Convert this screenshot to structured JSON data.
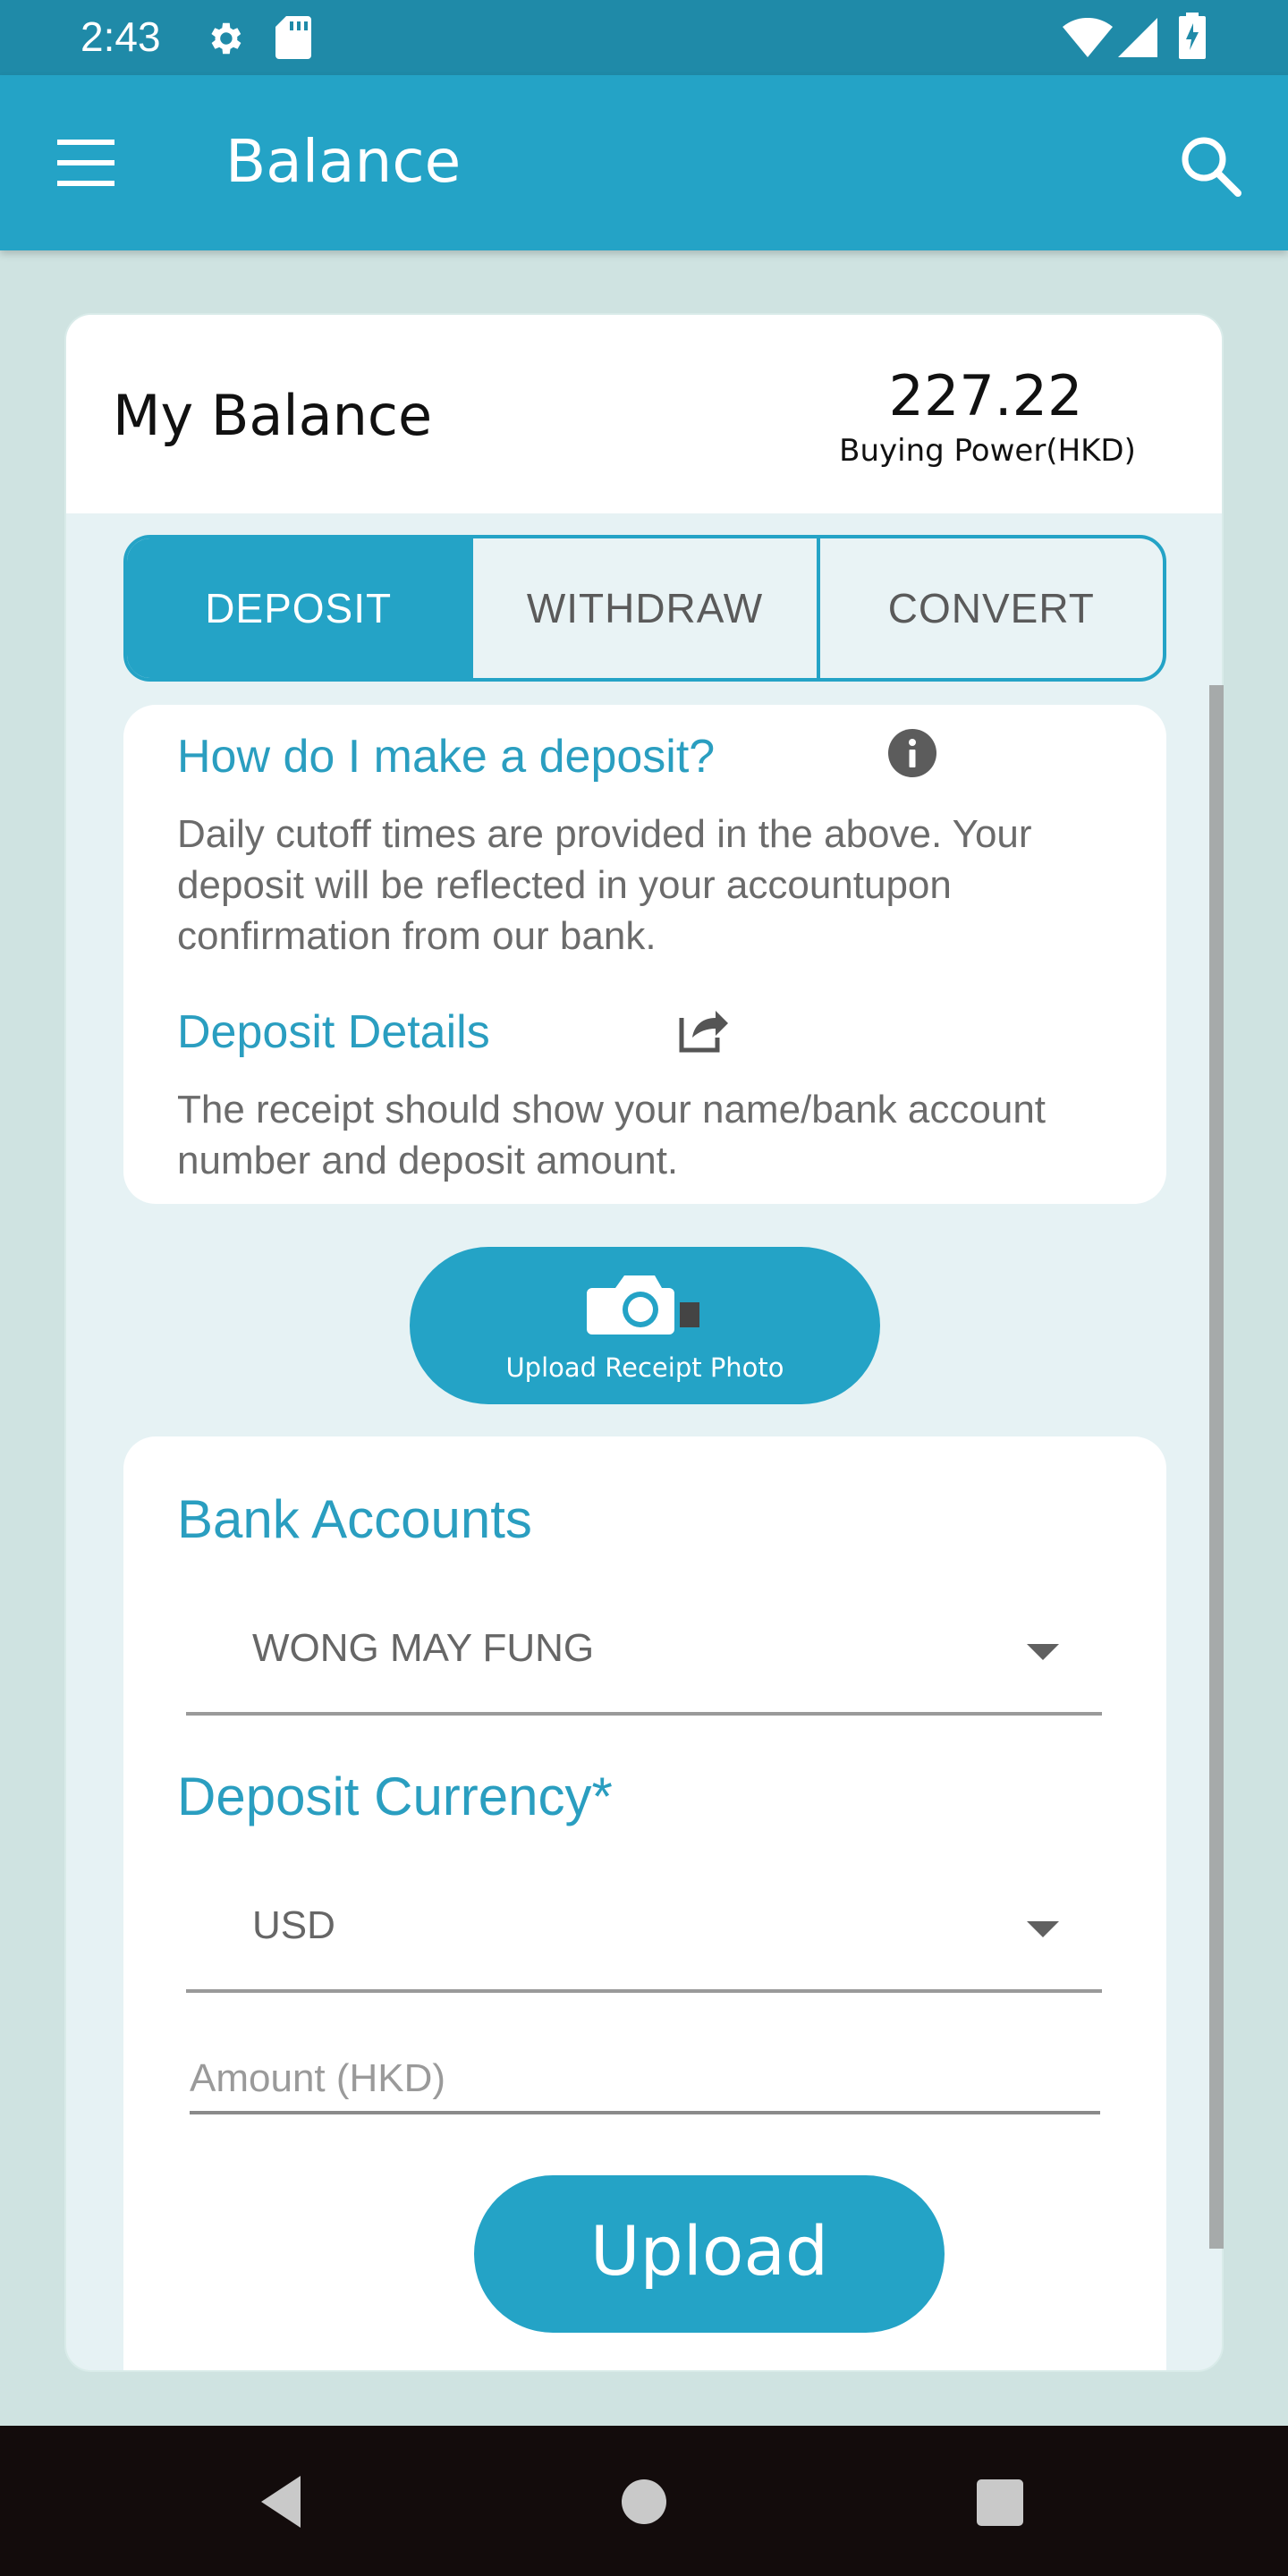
{
  "status_bar": {
    "time": "2:43",
    "icons": [
      "settings-icon",
      "sd-card-icon",
      "wifi-icon",
      "signal-icon",
      "battery-charging-icon"
    ]
  },
  "app_bar": {
    "title": "Balance",
    "menu_icon": "hamburger-menu-icon",
    "search_icon": "search-icon",
    "color": "#24a3c6"
  },
  "balance": {
    "title": "My Balance",
    "amount": "227.22",
    "label": "Buying Power(HKD)"
  },
  "tabs": [
    {
      "label": "DEPOSIT",
      "active": true
    },
    {
      "label": "WITHDRAW",
      "active": false
    },
    {
      "label": "CONVERT",
      "active": false
    }
  ],
  "info": {
    "question": "How do I make a deposit?",
    "question_icon": "info-icon",
    "text": "Daily cutoff times are provided in the above. Your deposit will be reflected in your accountupon confirmation from our bank.",
    "details_title": "Deposit Details",
    "details_icon": "share-icon",
    "details_text": "The receipt should show your name/bank account number and deposit amount."
  },
  "upload_receipt": {
    "label": "Upload Receipt Photo",
    "icon": "camera-icon"
  },
  "form": {
    "bank_accounts_title": "Bank Accounts",
    "bank_account_value": "WONG MAY FUNG",
    "currency_title": "Deposit Currency*",
    "currency_value": "USD",
    "amount_placeholder": "Amount (HKD)",
    "amount_value": "",
    "upload_label": "Upload"
  },
  "nav_bar": {
    "icons": [
      "back-icon",
      "home-icon",
      "recents-icon"
    ]
  }
}
